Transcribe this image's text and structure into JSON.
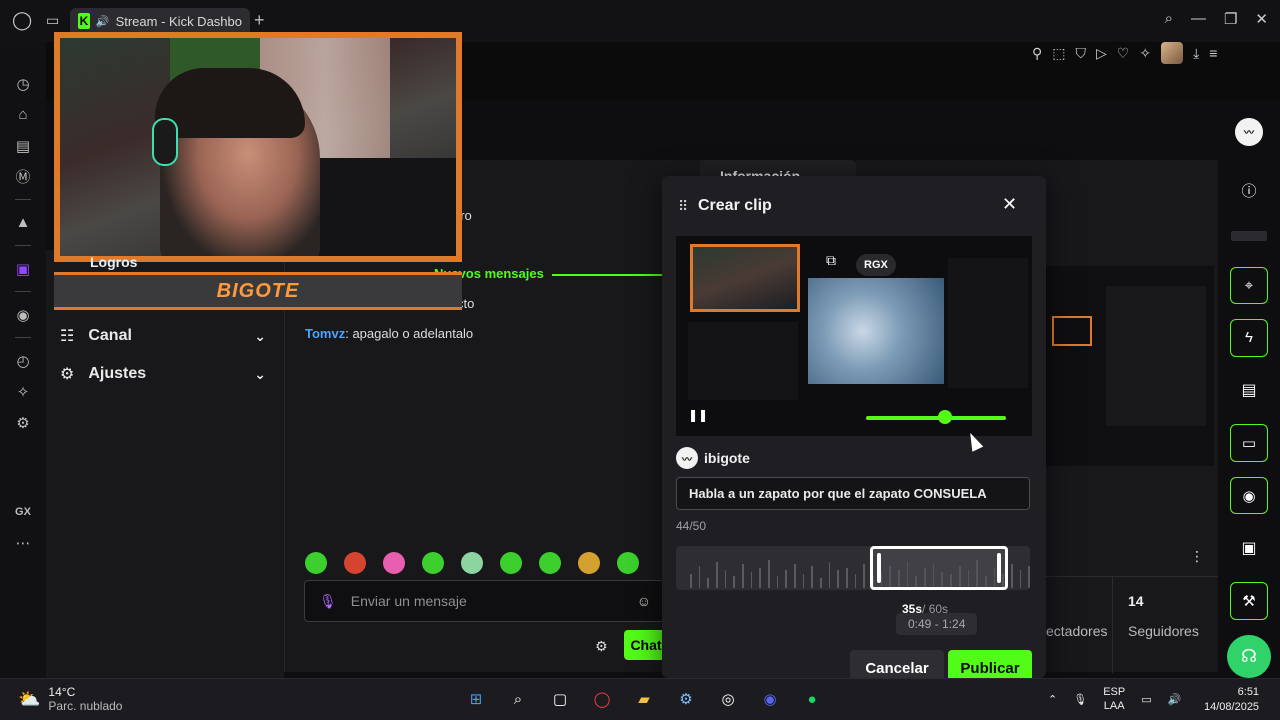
{
  "browser": {
    "tab_title": "Stream - Kick Dashbo",
    "new_tab": "+",
    "sidebar_label_gx": "GX"
  },
  "colors": {
    "accent": "#53fc18",
    "overlay": "#e07a2b",
    "surface": "#18181b",
    "modal": "#1f1f23"
  },
  "nav": {
    "logros": "Logros",
    "canal": "Canal",
    "ajustes": "Ajustes"
  },
  "overlay": {
    "nameplate": "BIGOTE"
  },
  "chat": {
    "tab_label": "Información",
    "fragment_1": "dro",
    "fragment_2": "cto",
    "new_messages": "Nuevos mensajes",
    "message": {
      "user": "Tomvz",
      "text": ": apagalo o adelantalo"
    },
    "input_placeholder": "Enviar un mensaje",
    "send_label": "Chat"
  },
  "stats": {
    "followers_value": "14",
    "followers_label": "Seguidores",
    "viewers_label": "ectadores"
  },
  "modal": {
    "title": "Crear clip",
    "preview_badge": "RGX",
    "username": "ibigote",
    "clip_title": "Habla a un zapato por que el zapato CONSUELA",
    "char_count": "44/50",
    "duration": "35s",
    "duration_total": "/ 60s",
    "range": "0:49 - 1:24",
    "cancel": "Cancelar",
    "publish": "Publicar"
  },
  "taskbar": {
    "temperature": "14°C",
    "weather": "Parc. nublado",
    "lang_1": "ESP",
    "lang_2": "LAA",
    "time": "6:51",
    "date": "14/08/2025"
  },
  "icons": {
    "rail": [
      "info-icon",
      "scan-icon",
      "bolt-icon",
      "document-icon",
      "chat-icon",
      "broadcast-icon",
      "layout-icon",
      "wrench-icon",
      "support-icon"
    ]
  }
}
